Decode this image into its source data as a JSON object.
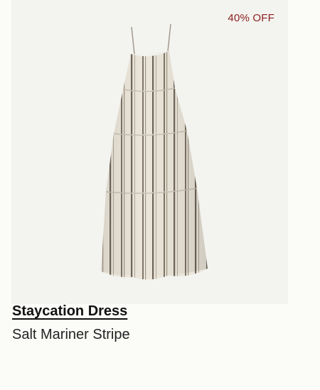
{
  "product": {
    "badge": "40% OFF",
    "name": "Staycation Dress",
    "variant": "Salt Mariner Stripe",
    "image_alt": "product-photo"
  },
  "colors": {
    "badge": "#8b1e1e",
    "image_background": "#f3f3ef",
    "page_background": "#fbfbf8",
    "fabric": "#ece6da",
    "stripe": "#7e7468"
  }
}
